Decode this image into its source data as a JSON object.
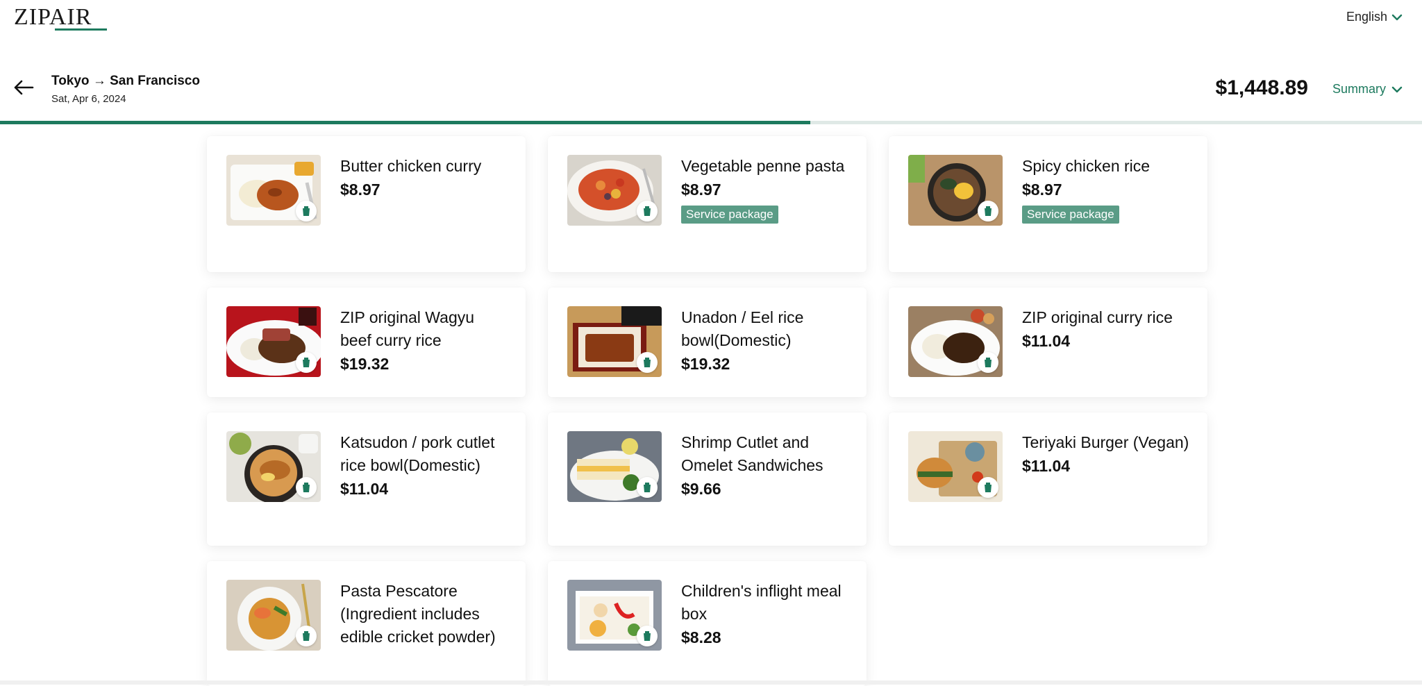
{
  "header": {
    "logo": "ZIPAIR",
    "language": "English"
  },
  "flight": {
    "route": "Tokyo → San Francisco",
    "date": "Sat, Apr 6, 2024",
    "total": "$1,448.89",
    "summary_label": "Summary"
  },
  "progress": {
    "fraction": 0.57
  },
  "colors": {
    "accent": "#1d7a5e",
    "badge": "#5a9c86",
    "text": "#111111"
  },
  "menu": [
    {
      "name": "Butter chicken curry",
      "price": "$8.97",
      "badge": "",
      "icon": "cart-icon"
    },
    {
      "name": "Vegetable penne pasta",
      "price": "$8.97",
      "badge": "Service package",
      "icon": "cart-icon"
    },
    {
      "name": "Spicy chicken rice",
      "price": "$8.97",
      "badge": "Service package",
      "icon": "cart-icon"
    },
    {
      "name": "ZIP original Wagyu beef curry rice",
      "price": "$19.32",
      "badge": "",
      "icon": "cart-icon"
    },
    {
      "name": "Unadon / Eel rice bowl(Domestic)",
      "price": "$19.32",
      "badge": "",
      "icon": "cart-icon"
    },
    {
      "name": "ZIP original curry rice",
      "price": "$11.04",
      "badge": "",
      "icon": "cart-icon"
    },
    {
      "name": "Katsudon / pork cutlet rice bowl(Domestic)",
      "price": "$11.04",
      "badge": "",
      "icon": "cart-icon"
    },
    {
      "name": "Shrimp Cutlet and Omelet Sandwiches",
      "price": "$9.66",
      "badge": "",
      "icon": "cart-icon"
    },
    {
      "name": "Teriyaki Burger (Vegan)",
      "price": "$11.04",
      "badge": "",
      "icon": "cart-icon"
    },
    {
      "name": "Pasta Pescatore (Ingredient includes edible cricket powder)",
      "price": "",
      "badge": "",
      "icon": "cart-icon"
    },
    {
      "name": "Children's inflight meal box",
      "price": "$8.28",
      "badge": "",
      "icon": "cart-icon"
    }
  ]
}
